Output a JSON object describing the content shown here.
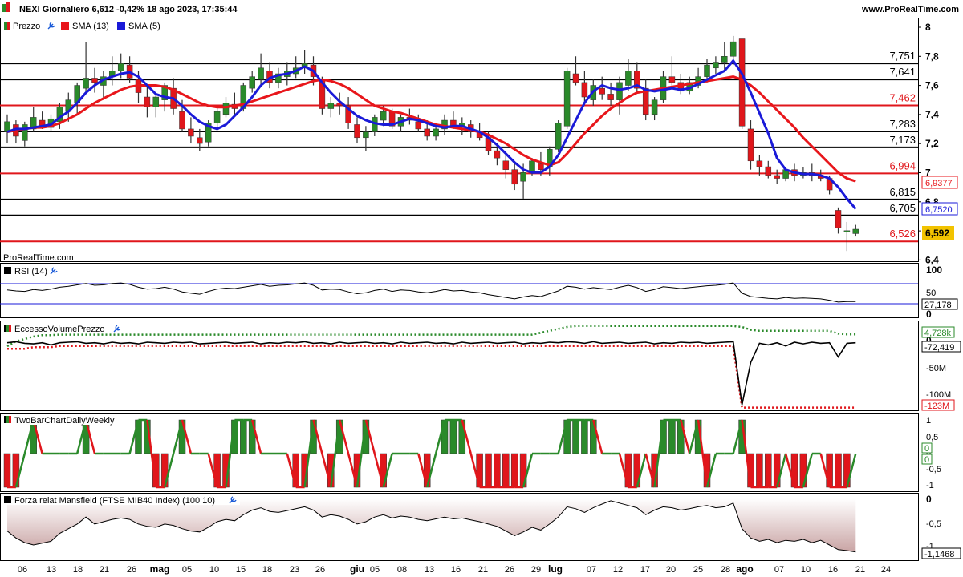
{
  "header": {
    "title": "NEXI Giornaliero 6,612 -0,42% 18 ago 2023, 17:35:44",
    "site": "www.ProRealTime.com",
    "watermark": "ProRealTime.com"
  },
  "colors": {
    "up": "#2a8a2a",
    "down": "#e0161b",
    "sma13": "#e8161b",
    "sma5": "#1a1ad8",
    "level_red": "#e0161b",
    "level_black": "#000000",
    "badge": "#f2c300"
  },
  "panels": {
    "price": {
      "legend": [
        "Prezzo",
        "SMA (13)",
        "SMA (5)"
      ]
    },
    "rsi": {
      "legend": "RSI (14)",
      "value_label": "27,178",
      "ticks": [
        "100",
        "50",
        "0"
      ]
    },
    "volume": {
      "legend": "EccessoVolumePrezzo",
      "labels": [
        "4,728k",
        "-72,419",
        "-123M"
      ],
      "ticks": [
        "0",
        "-50M",
        "-100M"
      ]
    },
    "twobar": {
      "legend": "TwoBarChartDailyWeekly",
      "ticks": [
        "1",
        "0,5",
        "0",
        "-0,5",
        "-1"
      ],
      "value_labels": [
        "0",
        "0"
      ]
    },
    "mansfield": {
      "legend": "Forza relat Mansfield (FTSE MIB40 Index) (100 10)",
      "ticks": [
        "0",
        "-0,5",
        "-1"
      ],
      "value_label": "-1,1468"
    }
  },
  "chart_data": {
    "type": "candlestick",
    "price_axis_ticks": [
      "8",
      "7,8",
      "7,6",
      "7,4",
      "7,2",
      "7",
      "6,8",
      "6,6",
      "6,4"
    ],
    "x_ticks": [
      "06",
      "13",
      "18",
      "21",
      "26",
      "mag",
      "05",
      "10",
      "15",
      "18",
      "23",
      "26",
      "giu",
      "05",
      "08",
      "13",
      "16",
      "21",
      "26",
      "29",
      "lug",
      "07",
      "12",
      "17",
      "20",
      "25",
      "28",
      "ago",
      "07",
      "10",
      "16",
      "21",
      "24"
    ],
    "levels": [
      {
        "label": "7,751",
        "value": 7.751,
        "color": "black"
      },
      {
        "label": "7,641",
        "value": 7.641,
        "color": "black"
      },
      {
        "label": "7,462",
        "value": 7.462,
        "color": "red"
      },
      {
        "label": "7,283",
        "value": 7.283,
        "color": "black"
      },
      {
        "label": "7,173",
        "value": 7.173,
        "color": "black"
      },
      {
        "label": "6,994",
        "value": 6.994,
        "color": "red"
      },
      {
        "label": "6,815",
        "value": 6.815,
        "color": "black"
      },
      {
        "label": "6,705",
        "value": 6.705,
        "color": "black"
      },
      {
        "label": "6,526",
        "value": 6.526,
        "color": "red"
      }
    ],
    "last_values": {
      "sma13": "6,9377",
      "sma5": "6,7520",
      "price": "6,592"
    },
    "candles": [
      [
        7.28,
        7.4,
        7.2,
        7.35
      ],
      [
        7.33,
        7.36,
        7.2,
        7.25
      ],
      [
        7.22,
        7.35,
        7.18,
        7.33
      ],
      [
        7.3,
        7.45,
        7.28,
        7.38
      ],
      [
        7.36,
        7.42,
        7.3,
        7.32
      ],
      [
        7.31,
        7.4,
        7.28,
        7.37
      ],
      [
        7.35,
        7.48,
        7.3,
        7.45
      ],
      [
        7.42,
        7.55,
        7.35,
        7.5
      ],
      [
        7.48,
        7.62,
        7.4,
        7.6
      ],
      [
        7.58,
        7.9,
        7.55,
        7.65
      ],
      [
        7.65,
        7.72,
        7.55,
        7.62
      ],
      [
        7.6,
        7.7,
        7.5,
        7.66
      ],
      [
        7.66,
        7.8,
        7.6,
        7.7
      ],
      [
        7.7,
        7.82,
        7.65,
        7.75
      ],
      [
        7.74,
        7.8,
        7.62,
        7.65
      ],
      [
        7.64,
        7.7,
        7.48,
        7.55
      ],
      [
        7.52,
        7.6,
        7.38,
        7.45
      ],
      [
        7.45,
        7.55,
        7.38,
        7.52
      ],
      [
        7.5,
        7.62,
        7.42,
        7.6
      ],
      [
        7.58,
        7.65,
        7.4,
        7.44
      ],
      [
        7.42,
        7.5,
        7.28,
        7.3
      ],
      [
        7.3,
        7.38,
        7.2,
        7.25
      ],
      [
        7.24,
        7.3,
        7.15,
        7.2
      ],
      [
        7.21,
        7.36,
        7.18,
        7.34
      ],
      [
        7.34,
        7.45,
        7.3,
        7.42
      ],
      [
        7.4,
        7.52,
        7.38,
        7.48
      ],
      [
        7.47,
        7.55,
        7.4,
        7.44
      ],
      [
        7.44,
        7.62,
        7.42,
        7.6
      ],
      [
        7.58,
        7.7,
        7.55,
        7.66
      ],
      [
        7.64,
        7.82,
        7.6,
        7.72
      ],
      [
        7.7,
        7.76,
        7.58,
        7.62
      ],
      [
        7.62,
        7.72,
        7.58,
        7.68
      ],
      [
        7.66,
        7.76,
        7.6,
        7.7
      ],
      [
        7.68,
        7.8,
        7.65,
        7.72
      ],
      [
        7.72,
        7.84,
        7.68,
        7.75
      ],
      [
        7.74,
        7.8,
        7.6,
        7.66
      ],
      [
        7.64,
        7.66,
        7.4,
        7.44
      ],
      [
        7.44,
        7.52,
        7.38,
        7.48
      ],
      [
        7.48,
        7.55,
        7.4,
        7.46
      ],
      [
        7.46,
        7.52,
        7.3,
        7.34
      ],
      [
        7.33,
        7.38,
        7.2,
        7.24
      ],
      [
        7.24,
        7.32,
        7.15,
        7.28
      ],
      [
        7.28,
        7.4,
        7.25,
        7.38
      ],
      [
        7.36,
        7.46,
        7.32,
        7.42
      ],
      [
        7.42,
        7.44,
        7.3,
        7.32
      ],
      [
        7.32,
        7.4,
        7.28,
        7.38
      ],
      [
        7.38,
        7.44,
        7.33,
        7.36
      ],
      [
        7.35,
        7.4,
        7.28,
        7.3
      ],
      [
        7.3,
        7.36,
        7.22,
        7.25
      ],
      [
        7.25,
        7.32,
        7.22,
        7.3
      ],
      [
        7.3,
        7.4,
        7.26,
        7.36
      ],
      [
        7.36,
        7.42,
        7.3,
        7.32
      ],
      [
        7.32,
        7.38,
        7.26,
        7.34
      ],
      [
        7.33,
        7.36,
        7.24,
        7.28
      ],
      [
        7.28,
        7.34,
        7.22,
        7.24
      ],
      [
        7.24,
        7.28,
        7.12,
        7.15
      ],
      [
        7.15,
        7.2,
        7.05,
        7.1
      ],
      [
        7.08,
        7.12,
        6.96,
        7.02
      ],
      [
        7.02,
        7.06,
        6.88,
        6.92
      ],
      [
        6.94,
        7.06,
        6.82,
        7.0
      ],
      [
        7.0,
        7.1,
        6.98,
        7.08
      ],
      [
        7.06,
        7.14,
        6.98,
        7.02
      ],
      [
        7.04,
        7.18,
        6.98,
        7.16
      ],
      [
        7.16,
        7.36,
        7.14,
        7.34
      ],
      [
        7.32,
        7.72,
        7.3,
        7.7
      ],
      [
        7.68,
        7.8,
        7.6,
        7.62
      ],
      [
        7.62,
        7.7,
        7.48,
        7.52
      ],
      [
        7.5,
        7.64,
        7.46,
        7.6
      ],
      [
        7.58,
        7.66,
        7.5,
        7.54
      ],
      [
        7.54,
        7.62,
        7.46,
        7.5
      ],
      [
        7.5,
        7.66,
        7.4,
        7.62
      ],
      [
        7.6,
        7.78,
        7.56,
        7.7
      ],
      [
        7.7,
        7.76,
        7.55,
        7.58
      ],
      [
        7.58,
        7.64,
        7.36,
        7.4
      ],
      [
        7.4,
        7.52,
        7.36,
        7.5
      ],
      [
        7.5,
        7.7,
        7.48,
        7.66
      ],
      [
        7.66,
        7.8,
        7.58,
        7.62
      ],
      [
        7.62,
        7.68,
        7.54,
        7.56
      ],
      [
        7.56,
        7.66,
        7.54,
        7.62
      ],
      [
        7.6,
        7.72,
        7.58,
        7.66
      ],
      [
        7.66,
        7.78,
        7.62,
        7.74
      ],
      [
        7.72,
        7.8,
        7.68,
        7.76
      ],
      [
        7.76,
        7.9,
        7.7,
        7.8
      ],
      [
        7.8,
        7.94,
        7.74,
        7.9
      ],
      [
        7.92,
        7.92,
        7.3,
        7.32
      ],
      [
        7.3,
        7.36,
        7.02,
        7.08
      ],
      [
        7.08,
        7.12,
        6.98,
        7.04
      ],
      [
        7.04,
        7.08,
        6.96,
        6.98
      ],
      [
        6.98,
        7.02,
        6.92,
        6.96
      ],
      [
        6.96,
        7.04,
        6.94,
        7.02
      ],
      [
        7.02,
        7.06,
        6.94,
        6.98
      ],
      [
        6.98,
        7.04,
        6.96,
        7.0
      ],
      [
        7.0,
        7.06,
        6.94,
        6.98
      ],
      [
        6.98,
        7.02,
        6.94,
        6.96
      ],
      [
        6.96,
        6.98,
        6.85,
        6.88
      ],
      [
        6.74,
        6.76,
        6.58,
        6.62
      ],
      [
        6.6,
        6.66,
        6.46,
        6.6
      ],
      [
        6.58,
        6.64,
        6.56,
        6.61
      ]
    ],
    "sma13": [
      7.28,
      7.29,
      7.3,
      7.31,
      7.31,
      7.32,
      7.34,
      7.37,
      7.4,
      7.44,
      7.48,
      7.51,
      7.54,
      7.57,
      7.59,
      7.6,
      7.6,
      7.6,
      7.59,
      7.57,
      7.54,
      7.51,
      7.48,
      7.46,
      7.45,
      7.45,
      7.46,
      7.47,
      7.49,
      7.51,
      7.53,
      7.55,
      7.57,
      7.59,
      7.61,
      7.63,
      7.64,
      7.63,
      7.61,
      7.58,
      7.54,
      7.5,
      7.46,
      7.44,
      7.42,
      7.41,
      7.39,
      7.37,
      7.35,
      7.33,
      7.32,
      7.31,
      7.3,
      7.29,
      7.28,
      7.26,
      7.23,
      7.2,
      7.16,
      7.12,
      7.09,
      7.07,
      7.05,
      7.07,
      7.13,
      7.2,
      7.27,
      7.33,
      7.39,
      7.44,
      7.48,
      7.52,
      7.55,
      7.56,
      7.57,
      7.58,
      7.59,
      7.6,
      7.61,
      7.62,
      7.63,
      7.64,
      7.65,
      7.66,
      7.64,
      7.6,
      7.55,
      7.49,
      7.43,
      7.37,
      7.31,
      7.24,
      7.18,
      7.12,
      7.06,
      7.0,
      6.96,
      6.94
    ],
    "sma5": [
      7.28,
      7.3,
      7.3,
      7.31,
      7.32,
      7.33,
      7.38,
      7.42,
      7.48,
      7.55,
      7.6,
      7.64,
      7.66,
      7.68,
      7.69,
      7.66,
      7.6,
      7.54,
      7.52,
      7.51,
      7.46,
      7.4,
      7.35,
      7.32,
      7.3,
      7.33,
      7.39,
      7.45,
      7.52,
      7.6,
      7.65,
      7.67,
      7.68,
      7.7,
      7.73,
      7.7,
      7.62,
      7.55,
      7.49,
      7.44,
      7.39,
      7.36,
      7.34,
      7.33,
      7.33,
      7.35,
      7.37,
      7.36,
      7.34,
      7.32,
      7.31,
      7.32,
      7.32,
      7.3,
      7.28,
      7.24,
      7.19,
      7.13,
      7.07,
      7.02,
      7.0,
      7.0,
      7.04,
      7.12,
      7.24,
      7.36,
      7.48,
      7.56,
      7.6,
      7.58,
      7.57,
      7.58,
      7.6,
      7.57,
      7.56,
      7.57,
      7.58,
      7.57,
      7.58,
      7.61,
      7.64,
      7.67,
      7.7,
      7.77,
      7.68,
      7.55,
      7.41,
      7.27,
      7.1,
      7.02,
      7.0,
      6.99,
      6.99,
      6.98,
      6.96,
      6.9,
      6.82,
      6.75
    ],
    "rsi": [
      52,
      50,
      49,
      53,
      51,
      54,
      58,
      60,
      63,
      66,
      62,
      63,
      66,
      67,
      64,
      58,
      54,
      55,
      58,
      54,
      48,
      45,
      43,
      49,
      54,
      56,
      55,
      58,
      61,
      64,
      60,
      62,
      63,
      65,
      67,
      62,
      52,
      54,
      53,
      48,
      44,
      46,
      51,
      54,
      49,
      52,
      51,
      48,
      46,
      49,
      53,
      50,
      51,
      48,
      46,
      42,
      39,
      36,
      33,
      37,
      40,
      38,
      44,
      50,
      60,
      58,
      54,
      57,
      55,
      53,
      58,
      62,
      57,
      49,
      53,
      59,
      57,
      55,
      57,
      59,
      61,
      62,
      64,
      67,
      45,
      38,
      36,
      34,
      33,
      36,
      34,
      35,
      34,
      33,
      30,
      26,
      27,
      27
    ],
    "volume_dots": [
      -20,
      -10,
      -5,
      0,
      3,
      3,
      4,
      4,
      4,
      4,
      4,
      4,
      4,
      4,
      4,
      4,
      4,
      4,
      4,
      4,
      4,
      4,
      4,
      4,
      4,
      4,
      4,
      4,
      4,
      4,
      4,
      4,
      4,
      4,
      4,
      4,
      4,
      4,
      4,
      4,
      4,
      4,
      4,
      4,
      4,
      4,
      4,
      4,
      4,
      4,
      4,
      4,
      4,
      4,
      4,
      4,
      4,
      4,
      4,
      4,
      4,
      8,
      12,
      16,
      20,
      22,
      22,
      22,
      22,
      22,
      22,
      22,
      22,
      22,
      22,
      22,
      22,
      22,
      22,
      22,
      22,
      22,
      22,
      22,
      20,
      14,
      12,
      12,
      12,
      12,
      12,
      12,
      12,
      12,
      12,
      6,
      4.7,
      4.7
    ],
    "volume_line": [
      -4,
      -2,
      -5,
      -6,
      -4,
      -8,
      -4,
      -3,
      -2,
      -5,
      -4,
      -6,
      -3,
      -5,
      -4,
      -6,
      -3,
      -4,
      -5,
      -3,
      -4,
      -3,
      -6,
      -5,
      -4,
      -3,
      -5,
      -4,
      -3,
      -6,
      -4,
      -5,
      -3,
      -4,
      -2,
      -5,
      -4,
      -6,
      -3,
      -5,
      -4,
      -3,
      -5,
      -4,
      -6,
      -3,
      -5,
      -4,
      -3,
      -5,
      -4,
      -6,
      -3,
      -5,
      -4,
      -3,
      -5,
      -4,
      -3,
      -6,
      -4,
      -5,
      -3,
      -4,
      -2,
      -3,
      -5,
      -2,
      -5,
      -4,
      -3,
      -5,
      -4,
      -3,
      -6,
      -4,
      -5,
      -3,
      -4,
      -3,
      -5,
      -4,
      -3,
      -2,
      -118,
      -40,
      -5,
      -8,
      -4,
      -10,
      -3,
      -6,
      -3,
      -5,
      -4,
      -30,
      -5,
      -4
    ],
    "volume_red": [
      -15,
      -15,
      -15,
      -12,
      -12,
      -12,
      -10,
      -10,
      -10,
      -10,
      -10,
      -10,
      -10,
      -10,
      -10,
      -10,
      -10,
      -10,
      -10,
      -10,
      -10,
      -10,
      -10,
      -10,
      -10,
      -10,
      -10,
      -10,
      -10,
      -10,
      -10,
      -10,
      -10,
      -10,
      -10,
      -10,
      -10,
      -10,
      -10,
      -10,
      -10,
      -10,
      -10,
      -10,
      -10,
      -10,
      -10,
      -10,
      -10,
      -10,
      -10,
      -10,
      -10,
      -10,
      -10,
      -10,
      -10,
      -10,
      -10,
      -10,
      -10,
      -10,
      -10,
      -10,
      -10,
      -10,
      -10,
      -10,
      -10,
      -10,
      -10,
      -10,
      -10,
      -10,
      -10,
      -10,
      -10,
      -10,
      -10,
      -10,
      -10,
      -10,
      -10,
      -10,
      -123,
      -123,
      -123,
      -123,
      -123,
      -123,
      -123,
      -123,
      -123,
      -123,
      -123,
      -123,
      -123,
      -123
    ],
    "twobar": [
      -1,
      -1,
      0,
      1,
      0,
      0,
      0,
      0,
      0,
      1,
      0,
      0,
      0,
      0,
      0,
      1,
      1,
      -1,
      -1,
      0,
      1,
      0,
      0,
      0,
      -1,
      -1,
      1,
      1,
      1,
      0,
      0,
      0,
      0,
      -1,
      -1,
      1,
      0,
      -1,
      1,
      0,
      -1,
      1,
      0,
      -1,
      0,
      0,
      0,
      0,
      -1,
      0,
      1,
      1,
      1,
      0,
      -1,
      -1,
      -1,
      -1,
      -1,
      -1,
      0,
      0,
      0,
      0,
      1,
      1,
      1,
      1,
      0,
      0,
      0,
      -1,
      -1,
      0,
      -1,
      1,
      1,
      1,
      0,
      1,
      -1,
      0,
      0,
      0,
      1,
      -1,
      -1,
      -1,
      -1,
      0,
      -1,
      -1,
      0,
      0,
      -1,
      -1,
      -1,
      0
    ],
    "mansfield": [
      -0.7,
      -0.85,
      -0.95,
      -1.0,
      -0.96,
      -0.92,
      -0.75,
      -0.65,
      -0.55,
      -0.4,
      -0.55,
      -0.5,
      -0.45,
      -0.42,
      -0.45,
      -0.55,
      -0.6,
      -0.62,
      -0.55,
      -0.58,
      -0.65,
      -0.7,
      -0.72,
      -0.62,
      -0.5,
      -0.45,
      -0.48,
      -0.35,
      -0.25,
      -0.2,
      -0.28,
      -0.3,
      -0.26,
      -0.22,
      -0.18,
      -0.25,
      -0.4,
      -0.35,
      -0.38,
      -0.45,
      -0.55,
      -0.5,
      -0.4,
      -0.35,
      -0.42,
      -0.38,
      -0.4,
      -0.45,
      -0.48,
      -0.44,
      -0.4,
      -0.44,
      -0.42,
      -0.46,
      -0.5,
      -0.55,
      -0.6,
      -0.7,
      -0.8,
      -0.72,
      -0.62,
      -0.68,
      -0.55,
      -0.4,
      -0.18,
      -0.22,
      -0.3,
      -0.2,
      -0.12,
      -0.05,
      -0.1,
      -0.15,
      -0.2,
      -0.35,
      -0.25,
      -0.18,
      -0.2,
      -0.25,
      -0.22,
      -0.18,
      -0.15,
      -0.2,
      -0.18,
      -0.1,
      -0.65,
      -0.85,
      -0.92,
      -0.88,
      -0.95,
      -0.9,
      -0.92,
      -0.88,
      -0.95,
      -0.9,
      -1.0,
      -1.1,
      -1.12,
      -1.15
    ]
  }
}
